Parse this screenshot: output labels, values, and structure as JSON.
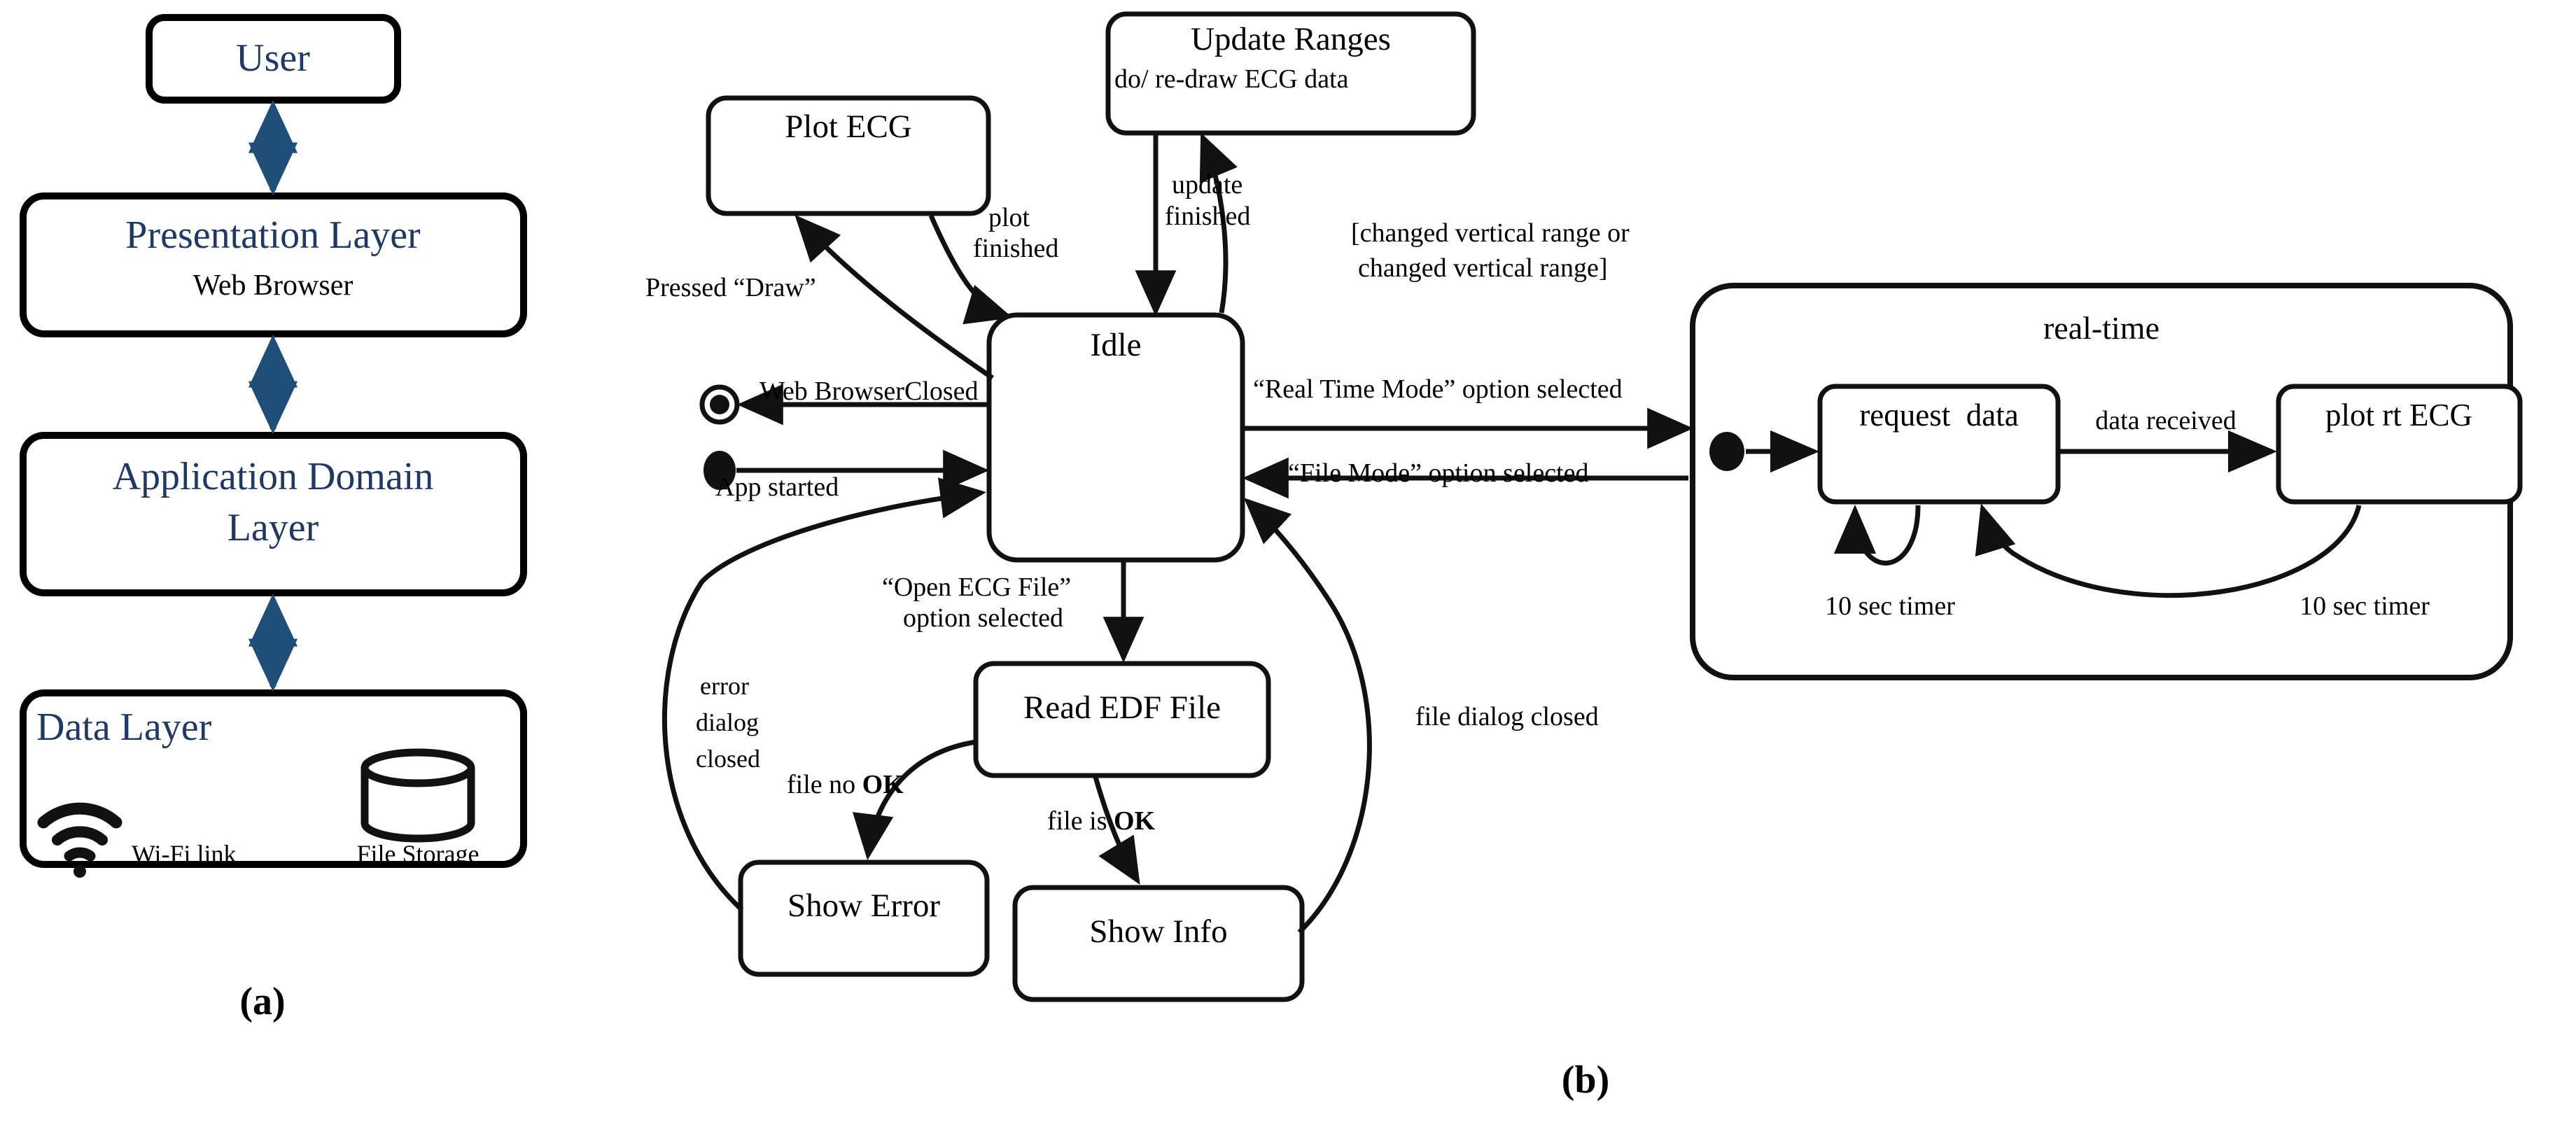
{
  "figure": {
    "caption_a": "(a)",
    "caption_b": "(b)"
  },
  "panel_a": {
    "name": "layered-architecture",
    "boxes": [
      {
        "title": "User",
        "subtitle": ""
      },
      {
        "title": "Presentation Layer",
        "subtitle": "Web Browser"
      },
      {
        "title": "Application Domain Layer",
        "subtitle": ""
      },
      {
        "title": "Data Layer",
        "subtitle": ""
      }
    ],
    "title_line1": "Application Domain",
    "title_line2": "Layer",
    "data_layer_items": [
      {
        "icon": "wifi-icon",
        "label": "Wi-Fi link"
      },
      {
        "icon": "database-icon",
        "label": "File Storage"
      }
    ],
    "accent_color": "#1F3864",
    "connector_color": "#1F4E79"
  },
  "panel_b": {
    "name": "ecg-application-state-machine",
    "states": [
      {
        "id": "plot-ecg",
        "name": "Plot ECG",
        "activity": ""
      },
      {
        "id": "update-ranges",
        "name": "Update Ranges",
        "activity": "do/ re-draw ECG data"
      },
      {
        "id": "idle",
        "name": "Idle",
        "activity": ""
      },
      {
        "id": "read-edf-file",
        "name": "Read EDF File",
        "activity": ""
      },
      {
        "id": "show-error",
        "name": "Show Error",
        "activity": ""
      },
      {
        "id": "show-info",
        "name": "Show Info",
        "activity": ""
      }
    ],
    "pseudostates": [
      {
        "id": "initial-state",
        "kind": "initial"
      },
      {
        "id": "final-state",
        "kind": "final"
      }
    ],
    "transitions": [
      {
        "id": "t-pressed-draw",
        "label_line1": "Pressed “Draw”",
        "label_line2": ""
      },
      {
        "id": "t-plot-finished",
        "label_line1": "plot",
        "label_line2": "finished"
      },
      {
        "id": "t-update-finished",
        "label_line1": "update",
        "label_line2": "finished"
      },
      {
        "id": "t-changed-range",
        "label_line1": "[changed vertical range or",
        "label_line2": "changed vertical range]"
      },
      {
        "id": "t-browser-closed",
        "label_line1": "Web BrowserClosed",
        "label_line2": ""
      },
      {
        "id": "t-app-started",
        "label_line1": "App started",
        "label_line2": ""
      },
      {
        "id": "t-realtime-mode",
        "label_line1": "“Real Time Mode” option selected",
        "label_line2": ""
      },
      {
        "id": "t-file-mode",
        "label_line1": "“File Mode” option selected",
        "label_line2": ""
      },
      {
        "id": "t-open-ecg-file",
        "label_line1": "“Open ECG File”",
        "label_line2": "option selected"
      },
      {
        "id": "t-error-dialog-closed",
        "label_line1": "error",
        "label_line2": "dialog",
        "label_line3": "closed"
      },
      {
        "id": "t-file-no-ok",
        "label_prefix": "file no ",
        "label_strong": "OK"
      },
      {
        "id": "t-file-is-ok",
        "label_prefix": "file is ",
        "label_strong": "OK"
      },
      {
        "id": "t-file-dialog-closed",
        "label_line1": "file dialog closed",
        "label_line2": ""
      }
    ],
    "composite": {
      "id": "real-time-region",
      "title": "real-time",
      "substates": [
        {
          "id": "request-data",
          "name": "request  data"
        },
        {
          "id": "plot-rt-ecg",
          "name": "plot rt ECG"
        }
      ],
      "transitions": [
        {
          "id": "t-data-received",
          "label": "data received"
        },
        {
          "id": "t-timer-request",
          "label": "10 sec timer"
        },
        {
          "id": "t-timer-plot",
          "label": "10 sec timer"
        }
      ]
    }
  }
}
